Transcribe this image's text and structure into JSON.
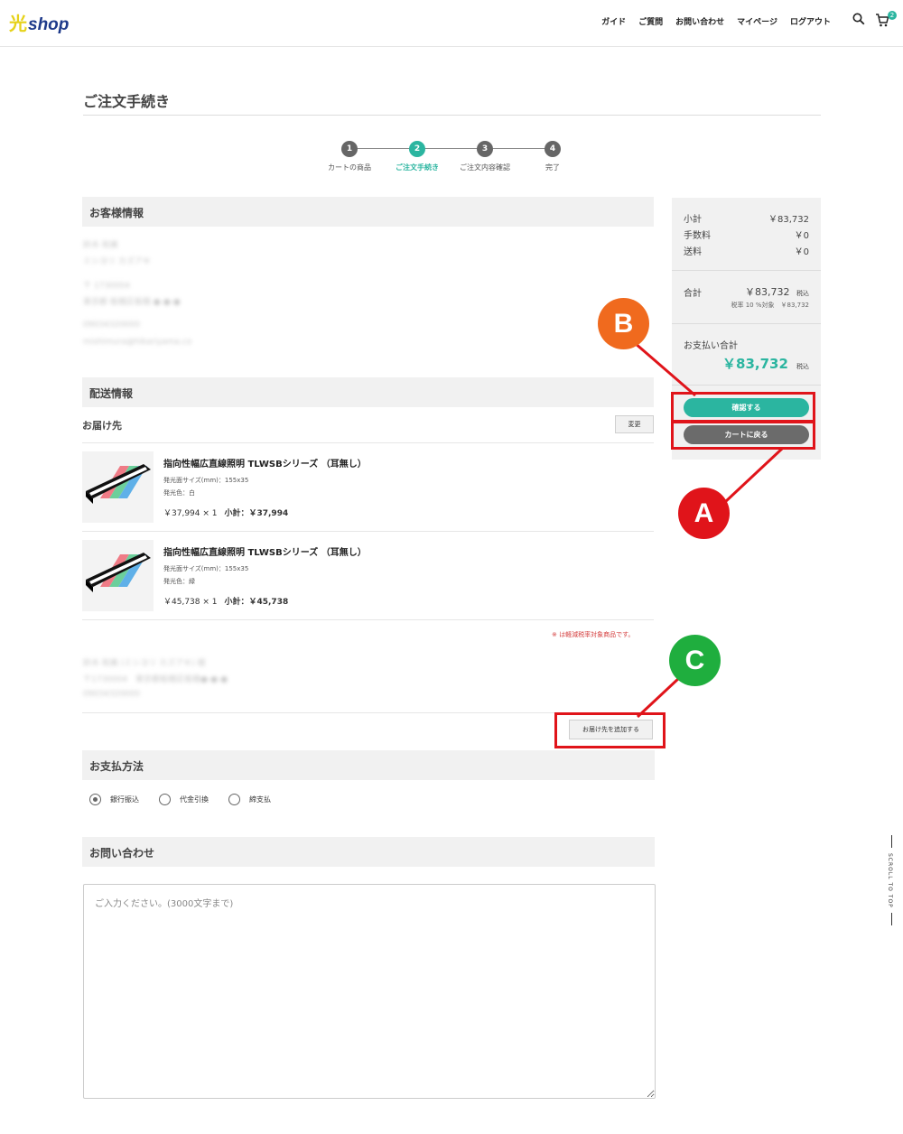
{
  "header": {
    "logo_kanji": "光",
    "logo_word": "shop",
    "nav": [
      "ガイド",
      "ご質問",
      "お問い合わせ",
      "マイページ",
      "ログアウト"
    ],
    "cart_count": "2"
  },
  "page_title": "ご注文手続き",
  "steps": [
    {
      "num": "1",
      "label": "カートの商品"
    },
    {
      "num": "2",
      "label": "ご注文手続き"
    },
    {
      "num": "3",
      "label": "ご注文内容確認"
    },
    {
      "num": "4",
      "label": "完了"
    }
  ],
  "customer": {
    "heading": "お客様情報",
    "lines": [
      "鈴木 和美",
      "ミシヨリ カズアキ",
      "〒 1730004",
      "東京都 板橋区板橋 ●-●-●",
      "09034320000",
      "mishimura@hikariyama.co"
    ]
  },
  "delivery": {
    "heading": "配送情報",
    "destination_label": "お届け先",
    "change_button": "変更",
    "items": [
      {
        "name": "指向性幅広直線照明 TLWSBシリーズ （耳無し）",
        "size": "発光面サイズ(mm)：155x35",
        "color": "発光色：白",
        "price": "￥37,994 × 1",
        "subtotal": "小計：￥37,994"
      },
      {
        "name": "指向性幅広直線照明 TLWSBシリーズ （耳無し）",
        "size": "発光面サイズ(mm)：155x35",
        "color": "発光色：緑",
        "price": "￥45,738 × 1",
        "subtotal": "小計：￥45,738"
      }
    ],
    "tax_note": "※ は軽減税率対象商品です。",
    "address_lines": [
      "鈴木 和美 (ミシヨリ カズアキ) 様",
      "〒1730004　東京都板橋区板橋●-●-●",
      "09034320000"
    ],
    "add_destination_button": "お届け先を追加する"
  },
  "payment": {
    "heading": "お支払方法",
    "options": [
      "銀行振込",
      "代金引換",
      "締支払"
    ],
    "selected": "銀行振込"
  },
  "inquiry": {
    "heading": "お問い合わせ",
    "placeholder": "ご入力ください。(3000文字まで)"
  },
  "summary": {
    "subtotal_label": "小計",
    "subtotal": "￥83,732",
    "fee_label": "手数料",
    "fee": "￥0",
    "shipping_label": "送料",
    "shipping": "￥0",
    "total_label": "合計",
    "total": "￥83,732",
    "tax_in": "税込",
    "tax_detail": "税率 10 %対象　￥83,732",
    "pay_total_label": "お支払い合計",
    "pay_total": "￥83,732",
    "pay_tax_in": "税込",
    "confirm_button": "確認する",
    "back_button": "カートに戻る"
  },
  "annotations": {
    "a": "A",
    "b": "B",
    "c": "C"
  },
  "scroll_top": "SCROLL TO TOP",
  "colors": {
    "accent": "#2bb5a0",
    "annotation_red": "#e0141a",
    "b_orange": "#f06a1e",
    "c_green": "#1fae3e"
  }
}
